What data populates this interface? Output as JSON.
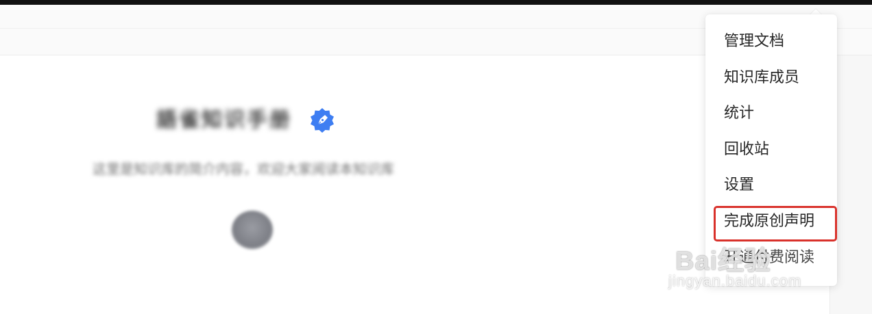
{
  "book": {
    "title": "語雀知识手册",
    "description": "这里是知识库的简介内容，欢迎大家阅读本知识库"
  },
  "menu": {
    "items": [
      {
        "label": "管理文档"
      },
      {
        "label": "知识库成员"
      },
      {
        "label": "统计"
      },
      {
        "label": "回收站"
      },
      {
        "label": "设置"
      },
      {
        "label": "完成原创声明"
      },
      {
        "label": "开通付费阅读"
      }
    ],
    "highlight_color": "#d9312b"
  },
  "badge": {
    "icon": "pen-verified-icon",
    "color": "#3e7ef2"
  },
  "watermark": {
    "brand": "Bai经验",
    "url": "jingyan.baidu.com"
  }
}
